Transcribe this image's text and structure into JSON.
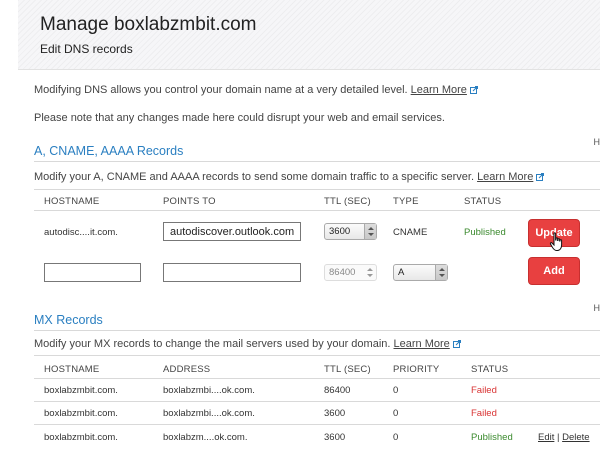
{
  "header": {
    "title": "Manage boxlabzmbit.com",
    "subtitle": "Edit DNS records"
  },
  "intro": {
    "line1": "Modifying DNS allows you control your domain name at a very detailed level.",
    "learn_more": "Learn More",
    "line2": "Please note that any changes made here could disrupt your web and email services."
  },
  "a_section": {
    "title": "A, CNAME, AAAA Records",
    "hint": "H",
    "description": "Modify your A, CNAME and AAAA records to send some domain traffic to a specific server.",
    "learn_more": "Learn More",
    "columns": {
      "hostname": "HOSTNAME",
      "points_to": "POINTS TO",
      "ttl": "TTL (SEC)",
      "type": "TYPE",
      "status": "STATUS"
    },
    "row": {
      "hostname": "autodisc....it.com.",
      "points_to": "autodiscover.outlook.com.",
      "ttl": "3600",
      "type": "CNAME",
      "status": "Published",
      "button": "Update"
    },
    "new_row": {
      "hostname": "",
      "points_to": "",
      "ttl": "86400",
      "type": "A",
      "button": "Add"
    }
  },
  "mx_section": {
    "title": "MX Records",
    "hint": "H",
    "description": "Modify your MX records to change the mail servers used by your domain.",
    "learn_more": "Learn More",
    "columns": {
      "hostname": "HOSTNAME",
      "address": "ADDRESS",
      "ttl": "TTL (SEC)",
      "priority": "PRIORITY",
      "status": "STATUS"
    },
    "rows": [
      {
        "hostname": "boxlabzmbit.com.",
        "address": "boxlabzmbi....ok.com.",
        "ttl": "86400",
        "priority": "0",
        "status": "Failed"
      },
      {
        "hostname": "boxlabzmbit.com.",
        "address": "boxlabzmbi....ok.com.",
        "ttl": "3600",
        "priority": "0",
        "status": "Failed"
      },
      {
        "hostname": "boxlabzmbit.com.",
        "address": "boxlabzm....ok.com.",
        "ttl": "3600",
        "priority": "0",
        "status": "Published",
        "edit": "Edit",
        "separator": "|",
        "delete": "Delete"
      }
    ]
  },
  "colors": {
    "section_title": "#2a7fc1",
    "button": "#e84040",
    "published": "#3b8a2e",
    "failed": "#d93333"
  },
  "icons": {
    "external_link": "external-link-icon",
    "select_arrows": "up-down-arrows-icon",
    "cursor": "hand-pointer-icon"
  }
}
